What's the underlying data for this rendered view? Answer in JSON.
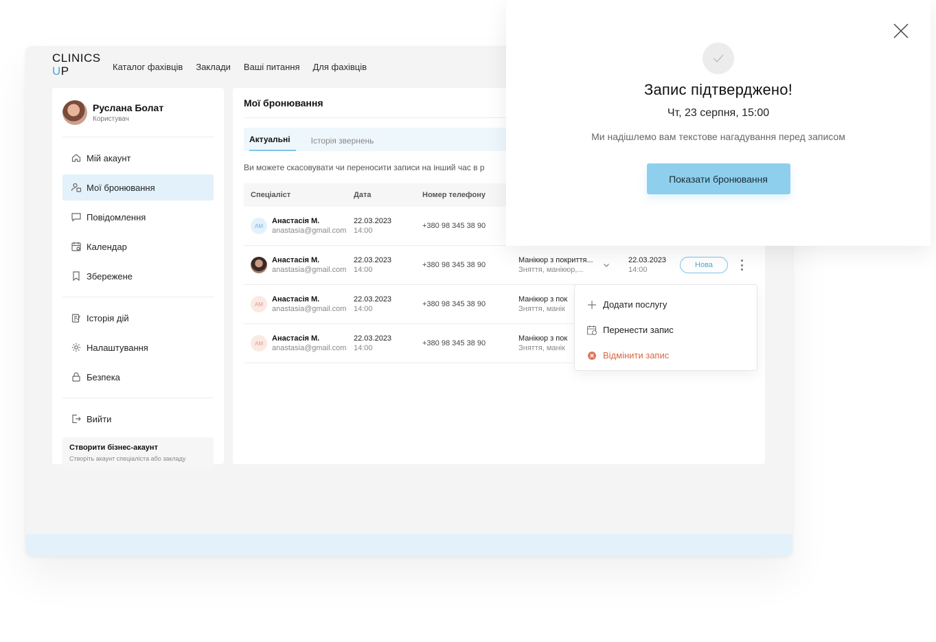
{
  "logo": {
    "line1": "CLINICS",
    "line2_u": "U",
    "line2_p": "P"
  },
  "nav": [
    "Каталог фахівців",
    "Заклади",
    "Ваші питання",
    "Для фахівців"
  ],
  "profile": {
    "name": "Руслана Болат",
    "role": "Користувач"
  },
  "sidebar": {
    "group1": [
      {
        "label": "Мій акаунт",
        "icon": "home-icon"
      },
      {
        "label": "Мої бронювання",
        "icon": "user-calendar-icon"
      },
      {
        "label": "Повідомлення",
        "icon": "message-icon"
      },
      {
        "label": "Календар",
        "icon": "calendar-icon"
      },
      {
        "label": "Збережене",
        "icon": "bookmark-icon"
      }
    ],
    "group2": [
      {
        "label": "Історія дій",
        "icon": "history-icon"
      },
      {
        "label": "Налаштування",
        "icon": "gear-icon"
      },
      {
        "label": "Безпека",
        "icon": "lock-icon"
      }
    ],
    "logout": "Вийти",
    "business": {
      "title": "Створити бізнес-акаунт",
      "subtitle": "Створіть акаунт спеціаліста або закладу"
    }
  },
  "main": {
    "title": "Мої бронювання",
    "tabs": [
      "Актуальні",
      "Історія звернень"
    ],
    "hint": "Ви можете скасовувати чи переносити записи на інший час в р",
    "headers": [
      "Спеціаліст",
      "Дата",
      "Номер телефону"
    ],
    "rows": [
      {
        "initials": "АМ",
        "name": "Анастасія М.",
        "email": "anastasia@gmail.com",
        "date": "22.03.2023",
        "time": "14:00",
        "phone": "+380 98 345 38 90"
      },
      {
        "initials": "",
        "name": "Анастасія М.",
        "email": "anastasia@gmail.com",
        "date": "22.03.2023",
        "time": "14:00",
        "phone": "+380 98 345 38 90",
        "service": "Манікюр з покриття...",
        "service_sub": "Зняття, манікюр,...",
        "date2": "22.03.2023",
        "time2": "14:00",
        "status": "Нова"
      },
      {
        "initials": "АМ",
        "name": "Анастасія М.",
        "email": "anastasia@gmail.com",
        "date": "22.03.2023",
        "time": "14:00",
        "phone": "+380 98 345 38 90",
        "service": "Манікюр з пок",
        "service_sub": "Зняття, манік"
      },
      {
        "initials": "АМ",
        "name": "Анастасія М.",
        "email": "anastasia@gmail.com",
        "date": "22.03.2023",
        "time": "14:00",
        "phone": "+380 98 345 38 90",
        "service": "Манікюр з пок",
        "service_sub": "Зняття, манік"
      }
    ]
  },
  "dropdown": {
    "items": [
      {
        "label": "Додати послугу",
        "icon": "plus-icon"
      },
      {
        "label": "Перенести запис",
        "icon": "calendar-clock-icon"
      },
      {
        "label": "Відмінити запис",
        "icon": "cancel-circle-icon"
      }
    ]
  },
  "modal": {
    "title": "Запис підтверджено!",
    "date": "Чт, 23 серпня, 15:00",
    "text": "Ми надішлемо вам текстове нагадування перед записом",
    "button": "Показати бронювання"
  },
  "colors": {
    "accent": "#8ecfee",
    "accent_light": "#e3f1fa",
    "danger": "#d9663f"
  }
}
